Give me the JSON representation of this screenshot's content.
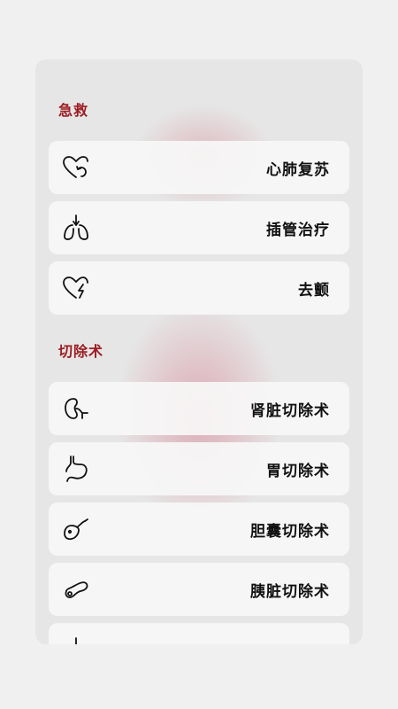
{
  "sections": [
    {
      "title": "急救",
      "items": [
        {
          "label": "心肺复苏",
          "icon": "heart-refresh-icon"
        },
        {
          "label": "插管治疗",
          "icon": "lungs-intubation-icon"
        },
        {
          "label": "去颤",
          "icon": "heart-bolt-icon"
        }
      ]
    },
    {
      "title": "切除术",
      "items": [
        {
          "label": "肾脏切除术",
          "icon": "kidney-icon"
        },
        {
          "label": "胃切除术",
          "icon": "stomach-icon"
        },
        {
          "label": "胆囊切除术",
          "icon": "gallbladder-icon"
        },
        {
          "label": "胰脏切除术",
          "icon": "pancreas-icon"
        },
        {
          "label": "",
          "icon": "partially-hidden-icon"
        }
      ]
    }
  ],
  "colors": {
    "accent": "#9c1c23",
    "background": "#f0f0f0",
    "panel": "#e6e6e6",
    "card": "#f7f7f7"
  }
}
